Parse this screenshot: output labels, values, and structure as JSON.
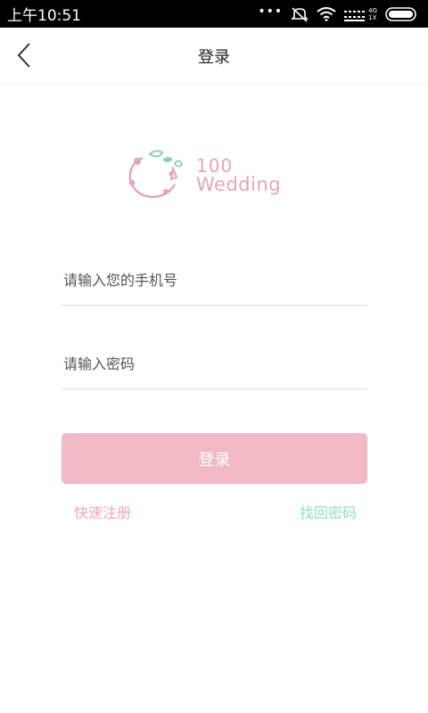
{
  "status_bar": {
    "time": "上午10:51",
    "dots": "•••",
    "network_top": "4G",
    "network_bottom": "1X"
  },
  "nav": {
    "title": "登录",
    "back_icon": "chevron-left-icon"
  },
  "logo": {
    "number": "100",
    "word": "Wedding",
    "color": "#e5a5b6",
    "leaf_color": "#8fd1b5"
  },
  "form": {
    "phone_placeholder": "请输入您的手机号",
    "password_placeholder": "请输入密码",
    "login_label": "登录",
    "login_color": "#f0b9c4"
  },
  "links": {
    "register": "快速注册",
    "register_color": "#f2a5b8",
    "forgot": "找回密码",
    "forgot_color": "#8ee3c4"
  }
}
